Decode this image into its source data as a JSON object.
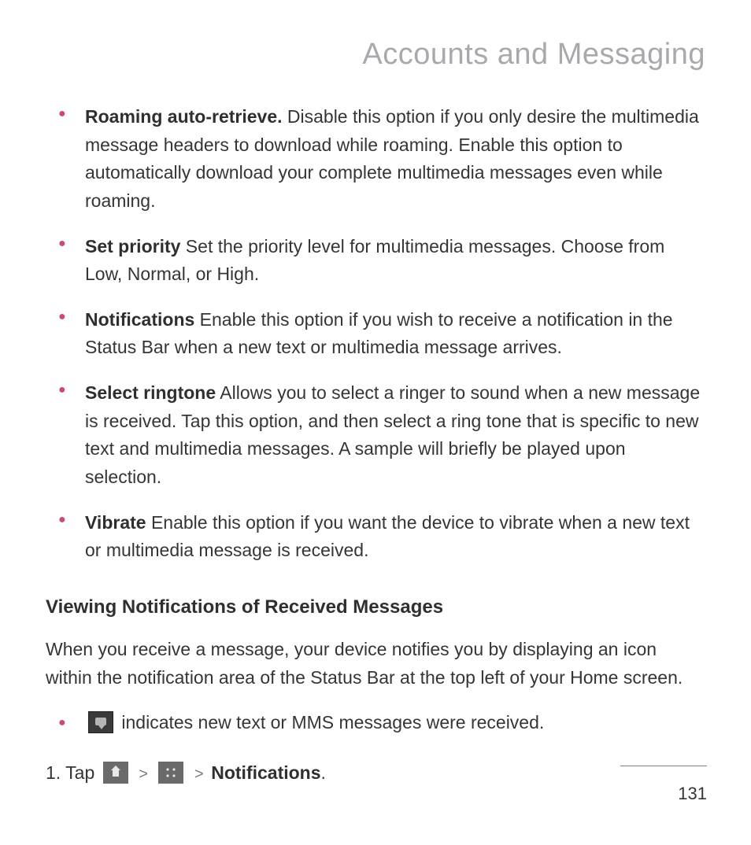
{
  "title": "Accounts and Messaging",
  "bullets": [
    {
      "term": "Roaming auto-retrieve.",
      "desc": " Disable this option if you only desire the multimedia message headers to download while roaming. Enable this option to automatically download your complete multimedia messages even while roaming."
    },
    {
      "term": "Set priority",
      "desc": " Set the priority level for multimedia messages. Choose from Low, Normal, or High."
    },
    {
      "term": "Notifications",
      "desc": " Enable this option if you wish to receive a notification in the Status Bar when a new text or multimedia message arrives."
    },
    {
      "term": "Select ringtone",
      "desc": " Allows you to select a ringer to sound when a new message is received. Tap this option, and then select a ring tone that is specific to new text and multimedia messages. A sample will briefly be played upon selection."
    },
    {
      "term": "Vibrate",
      "desc": " Enable this option if you want the device to vibrate when a new text or multimedia message is received."
    }
  ],
  "section_heading": "Viewing Notifications of Received Messages",
  "section_body": "When you receive a message, your device notifies you by displaying an icon within the notification area of the Status Bar at the top left of your Home screen.",
  "icon_bullet_text": " indicates new text or MMS messages were received.",
  "step": {
    "num": "1.",
    "verb": " Tap ",
    "sep": " > ",
    "end": "Notifications",
    "period": "."
  },
  "page_number": "131"
}
